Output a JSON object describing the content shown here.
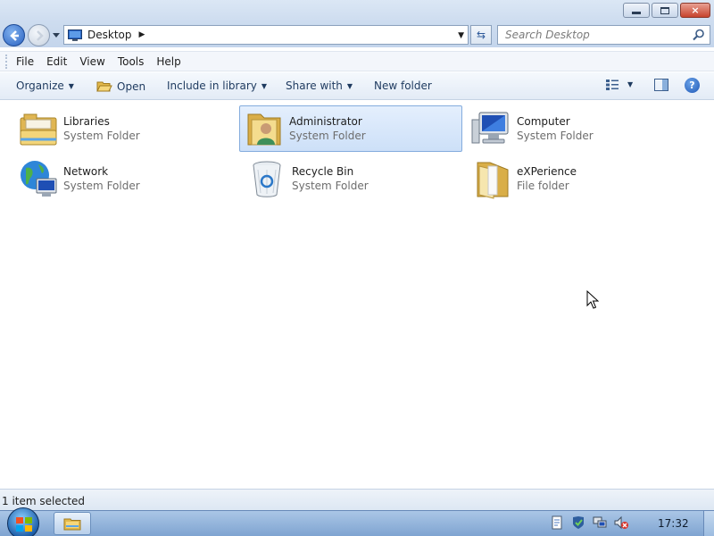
{
  "window": {
    "caption_buttons": {
      "minimize": "minimize-icon",
      "maximize": "restore-icon",
      "close": "×"
    }
  },
  "navigation": {
    "address": {
      "location": "Desktop",
      "separator": "▶",
      "dropdown": "▼"
    },
    "refresh_icon": "⇆",
    "search": {
      "placeholder": "Search Desktop"
    }
  },
  "menubar": {
    "items": [
      "File",
      "Edit",
      "View",
      "Tools",
      "Help"
    ]
  },
  "commandbar": {
    "organize": "Organize",
    "open": "Open",
    "include_in_library": "Include in library",
    "share_with": "Share with",
    "new_folder": "New folder",
    "dropdown_arrow": "▼",
    "help_symbol": "?"
  },
  "content": {
    "items": [
      {
        "name": "Libraries",
        "type": "System Folder",
        "icon": "libraries-icon",
        "selected": false
      },
      {
        "name": "Administrator",
        "type": "System Folder",
        "icon": "user-folder-icon",
        "selected": true
      },
      {
        "name": "Computer",
        "type": "System Folder",
        "icon": "computer-icon",
        "selected": false
      },
      {
        "name": "Network",
        "type": "System Folder",
        "icon": "network-icon",
        "selected": false
      },
      {
        "name": "Recycle Bin",
        "type": "System Folder",
        "icon": "recycle-bin-icon",
        "selected": false
      },
      {
        "name": "eXPerience",
        "type": "File folder",
        "icon": "folder-icon",
        "selected": false
      }
    ]
  },
  "statusbar": {
    "text": "1 item selected"
  },
  "taskbar": {
    "clock": "17:32"
  },
  "colors": {
    "selection_bg": "#cde0f8",
    "selection_border": "#84acdd",
    "secondary_text": "#6d6d6d",
    "taskbar": "#7fa4d1"
  }
}
